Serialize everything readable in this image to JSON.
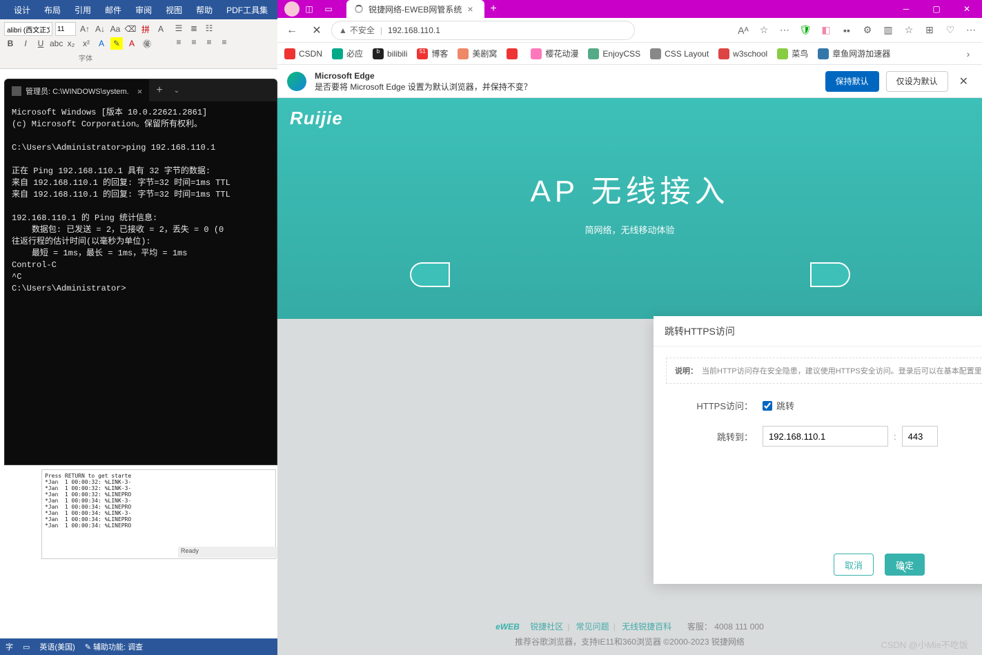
{
  "word": {
    "menu": [
      "设计",
      "布局",
      "引用",
      "邮件",
      "审阅",
      "视图",
      "帮助",
      "PDF工具集"
    ],
    "font": "alibri (西文正文)",
    "size": "11",
    "section_font": "字体",
    "doc_snip": "Press RETURN to get starte\n*Jan  1 00:00:32: %LINK-3-\n*Jan  1 00:00:32: %LINK-3-\n*Jan  1 00:00:32: %LINEPRO\n*Jan  1 00:00:34: %LINK-3-\n*Jan  1 00:00:34: %LINEPRO\n*Jan  1 00:00:34: %LINK-3-\n*Jan  1 00:00:34: %LINEPRO\n*Jan  1 00:00:34: %LINEPRO",
    "ready": "Ready",
    "status": {
      "lang": "英语(美国)",
      "acc": "辅助功能: 调查"
    }
  },
  "terminal": {
    "tab_title": "管理员: C:\\WINDOWS\\system.",
    "lines": "Microsoft Windows [版本 10.0.22621.2861]\n(c) Microsoft Corporation。保留所有权利。\n\nC:\\Users\\Administrator>ping 192.168.110.1\n\n正在 Ping 192.168.110.1 具有 32 字节的数据:\n来自 192.168.110.1 的回复: 字节=32 时间=1ms TTL\n来自 192.168.110.1 的回复: 字节=32 时间=1ms TTL\n\n192.168.110.1 的 Ping 统计信息:\n    数据包: 已发送 = 2，已接收 = 2，丢失 = 0 (0\n往返行程的估计时间(以毫秒为单位):\n    最短 = 1ms，最长 = 1ms，平均 = 1ms\nControl-C\n^C\nC:\\Users\\Administrator>"
  },
  "browser": {
    "tab_title": "锐捷网络-EWEB网管系统",
    "insecure": "不安全",
    "url": "192.168.110.1",
    "favs": [
      {
        "label": "CSDN",
        "color": "#e33"
      },
      {
        "label": "必应",
        "color": "#0a8"
      },
      {
        "label": "bilibili",
        "color": "#222"
      },
      {
        "label": "博客",
        "color": "#e33"
      },
      {
        "label": "美剧窝",
        "color": "#e86"
      },
      {
        "label": "",
        "color": "#e33"
      },
      {
        "label": "樱花动漫",
        "color": "#f7b"
      },
      {
        "label": "EnjoyCSS",
        "color": "#5a8"
      },
      {
        "label": "CSS Layout",
        "color": "#888"
      },
      {
        "label": "w3school",
        "color": "#d44"
      },
      {
        "label": "菜鸟",
        "color": "#8c4"
      },
      {
        "label": "章鱼网游加速器",
        "color": "#37a"
      }
    ],
    "banner": {
      "title": "Microsoft Edge",
      "msg": "是否要将 Microsoft Edge 设置为默认浏览器，并保持不变？",
      "primary": "保持默认",
      "secondary": "仅设为默认"
    }
  },
  "page": {
    "logo": "Ruijie",
    "title": "AP 无线接入",
    "subtitle": "简网络，无线移动体验",
    "footer_links": [
      "锐捷社区",
      "常见问题",
      "无线锐捷百科"
    ],
    "service_label": "客服：",
    "service_phone": "4008 111 000",
    "footer_note": "推荐谷歌浏览器，支持IE11和360浏览器   ©2000-2023  锐捷网络",
    "eweb": "eWEB"
  },
  "modal": {
    "title": "跳转HTTPS访问",
    "note_label": "说明：",
    "note": "当前HTTP访问存在安全隐患，建议使用HTTPS安全访问。登录后可以在基本配置里面配置HTTP自动重定向",
    "https_label": "HTTPS访问：",
    "jump_chk": "跳转",
    "redirect_label": "跳转到：",
    "ip": "192.168.110.1",
    "port": "443",
    "cancel": "取消",
    "ok": "确定"
  },
  "watermark": "CSDN @小Mie不吃饭"
}
